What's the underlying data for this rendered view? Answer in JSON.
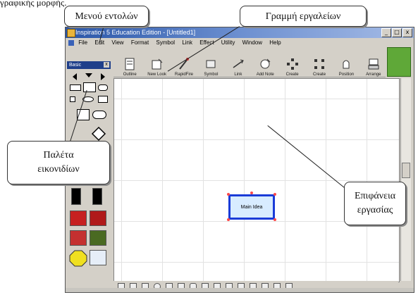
{
  "page_caption": "γραφικής μορφής.",
  "window": {
    "title": "Inspiration 5 Education Edition - [Untitled1]",
    "controls": [
      "_",
      "□",
      "x"
    ]
  },
  "menu": [
    "File",
    "Edit",
    "View",
    "Format",
    "Symbol",
    "Link",
    "Effect",
    "Utility",
    "Window",
    "Help"
  ],
  "toolbar": {
    "buttons": [
      {
        "label": "Outline",
        "icon": "outline-icon"
      },
      {
        "label": "New Look",
        "icon": "new-look-icon"
      },
      {
        "label": "RapidFire",
        "icon": "rapidfire-icon"
      },
      {
        "label": "Symbol",
        "icon": "symbol-icon"
      },
      {
        "label": "Link",
        "icon": "link-icon"
      },
      {
        "label": "Add Note",
        "icon": "add-note-icon"
      },
      {
        "label": "Create",
        "icon": "create-icon"
      },
      {
        "label": "Create",
        "icon": "create-icon"
      },
      {
        "label": "Position",
        "icon": "position-icon"
      },
      {
        "label": "Arrange",
        "icon": "arrange-icon"
      }
    ]
  },
  "palette": {
    "title": "Basic",
    "close": "x"
  },
  "canvas": {
    "main_idea": "Main Idea"
  },
  "callouts": {
    "menu": "Μενού εντολών",
    "toolbar": "Γραμμή εργαλείων",
    "palette_line1": "Παλέτα",
    "palette_line2": "εικονιδίων",
    "workspace_line1": "Επιφάνεια",
    "workspace_line2": "εργασίας"
  },
  "colors": {
    "titlebar": "#2a56a8",
    "main_idea_border": "#1a3bd8",
    "main_idea_fill": "#d8ecff"
  }
}
